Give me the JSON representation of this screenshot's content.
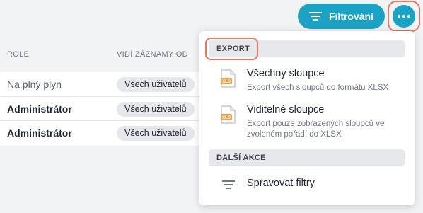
{
  "toolbar": {
    "filter_label": "Filtrování",
    "filter_icon": "filter-lines-icon",
    "more_icon": "more-dots-icon"
  },
  "table": {
    "headers": {
      "role": "ROLE",
      "visible": "VIDÍ ZÁZNAMY OD"
    },
    "rows": [
      {
        "role": "Na plný plyn",
        "visible": "Všech uživatelů"
      },
      {
        "role": "Administrátor",
        "visible": "Všech uživatelů"
      },
      {
        "role": "Administrátor",
        "visible": "Všech uživatelů"
      }
    ]
  },
  "menu": {
    "export_section": "EXPORT",
    "items": [
      {
        "title": "Všechny sloupce",
        "desc": "Export všech sloupců do formátu XLSX",
        "icon": "xls-file-icon"
      },
      {
        "title": "Viditelné sloupce",
        "desc": "Export pouze zobrazených sloupců ve zvoleném pořadí do XLSX",
        "icon": "xls-file-icon"
      }
    ],
    "more_section": "DALŠÍ AKCE",
    "manage_filters": {
      "title": "Spravovat filtry",
      "icon": "filter-lines-icon"
    }
  },
  "colors": {
    "accent": "#1ba3c6",
    "highlight": "#e8775f",
    "xls_icon": "#f0a250"
  }
}
